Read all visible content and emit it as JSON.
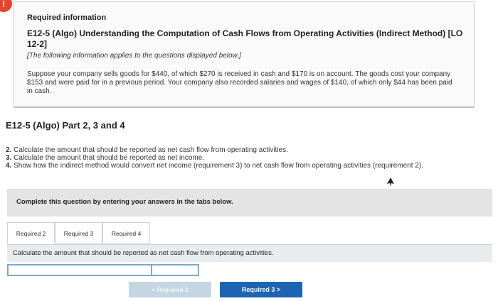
{
  "alert": {
    "symbol": "!"
  },
  "info": {
    "heading": "Required information",
    "title": "E12-5 (Algo) Understanding the Computation of Cash Flows from Operating Activities (Indirect Method) [LO 12-2]",
    "note": "[The following information applies to the questions displayed below.]",
    "body": "Suppose your company sells goods for $440, of which $270 is received in cash and $170 is on account. The goods cost your company $153 and were paid for in a previous period. Your company also recorded salaries and wages of $140, of which only $44 has been paid in cash."
  },
  "part": {
    "title": "E12-5 (Algo) Part 2, 3 and 4"
  },
  "questions": [
    {
      "num": "2.",
      "text": "Calculate the amount that should be reported as net cash flow from operating activities."
    },
    {
      "num": "3.",
      "text": "Calculate the amount that should be reported as net income."
    },
    {
      "num": "4.",
      "text": "Show how the indirect method would convert net income (requirement 3) to net cash flow from operating activities (requirement 2)."
    }
  ],
  "instructions": "Complete this question by entering your answers in the tabs below.",
  "tabs": [
    {
      "label": "Required 2",
      "active": true
    },
    {
      "label": "Required 3",
      "active": false
    },
    {
      "label": "Required 4",
      "active": false
    }
  ],
  "current_question": "Calculate the amount that should be reported as net cash flow from operating activities.",
  "answer": {
    "label_value": "",
    "amount_value": ""
  },
  "nav": {
    "prev_label": "< Required 2",
    "next_label": "Required 3  >"
  }
}
